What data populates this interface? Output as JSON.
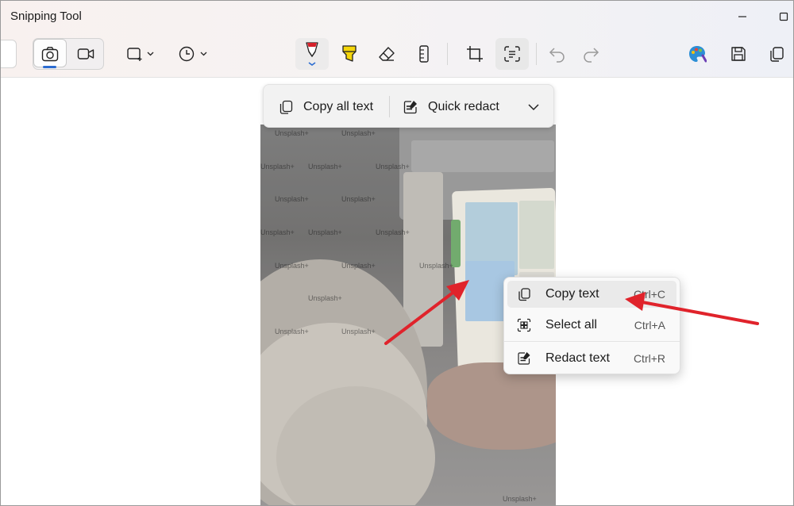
{
  "window": {
    "title": "Snipping Tool"
  },
  "colors": {
    "accent": "#2a6bd0",
    "pen_red": "#d6202a",
    "highlighter_yellow": "#f5d60a",
    "arrow_red": "#e0232b"
  },
  "toolbar": {
    "mode_icons": [
      "camera-icon",
      "video-icon"
    ],
    "tool_icons": [
      "rectangle-snip-icon",
      "timer-icon",
      "pen-icon",
      "highlighter-icon",
      "eraser-icon",
      "ruler-icon",
      "crop-icon",
      "text-actions-icon",
      "undo-icon",
      "redo-icon",
      "paint-icon",
      "save-icon",
      "copy-icon"
    ]
  },
  "ocr_bar": {
    "copy_all_text": "Copy all text",
    "quick_redact": "Quick redact"
  },
  "context_menu": {
    "items": [
      {
        "label": "Copy text",
        "shortcut": "Ctrl+C",
        "icon": "copy-icon"
      },
      {
        "label": "Select all",
        "shortcut": "Ctrl+A",
        "icon": "select-all-icon"
      },
      {
        "label": "Redact text",
        "shortcut": "Ctrl+R",
        "icon": "redact-icon"
      }
    ]
  },
  "watermark_text": "Unsplash+"
}
